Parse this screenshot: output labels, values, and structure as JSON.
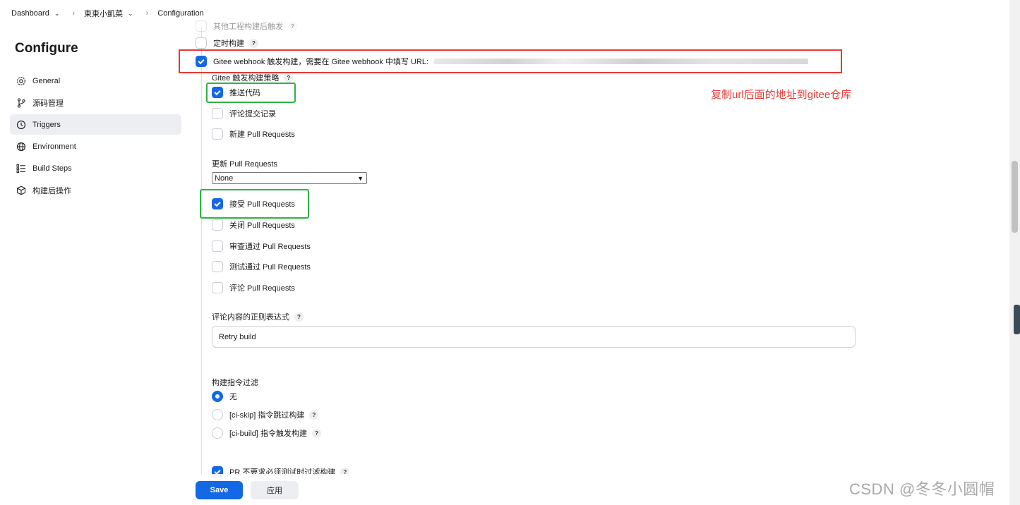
{
  "breadcrumb": {
    "dashboard": "Dashboard",
    "project": "東東小凱菜",
    "current": "Configuration"
  },
  "page_title": "Configure",
  "sidebar": {
    "items": [
      {
        "label": "General",
        "icon": "gear-icon"
      },
      {
        "label": "源码管理",
        "icon": "branch-icon"
      },
      {
        "label": "Triggers",
        "icon": "clock-icon",
        "active": true
      },
      {
        "label": "Environment",
        "icon": "globe-icon"
      },
      {
        "label": "Build Steps",
        "icon": "list-icon"
      },
      {
        "label": "构建后操作",
        "icon": "cube-icon"
      }
    ]
  },
  "triggers": {
    "other_trigger": "其他工程构建后触发",
    "scheduled": "定时构建",
    "gitee_webhook": "Gitee webhook 触发构建，需要在 Gitee webhook 中填写 URL:",
    "strategy_label": "Gitee 触发构建策略",
    "push_code": "推送代码",
    "comment_commit": "评论提交记录",
    "new_pr": "新建 Pull Requests",
    "update_pr_label": "更新 Pull Requests",
    "update_pr_value": "None",
    "accept_pr": "接受 Pull Requests",
    "close_pr": "关闭 Pull Requests",
    "review_pass_pr": "审查通过 Pull Requests",
    "test_pass_pr": "测试通过 Pull Requests",
    "comment_pr": "评论 Pull Requests",
    "comment_regex_label": "评论内容的正则表达式",
    "comment_regex_value": "Retry build",
    "filter_label": "构建指令过滤",
    "filter_none": "无",
    "filter_skip": "[ci-skip] 指令跳过构建",
    "filter_build": "[ci-build] 指令触发构建",
    "pr_filter": "PR 不要求必须测试时过滤构建"
  },
  "help_mark": "?",
  "annotation": "复制url后面的地址到gitee仓库",
  "buttons": {
    "save": "Save",
    "apply": "应用"
  },
  "watermark": "CSDN @冬冬小圆帽",
  "colors": {
    "accent": "#1468e6",
    "red_box": "#e53935",
    "green_box": "#2fb344"
  }
}
